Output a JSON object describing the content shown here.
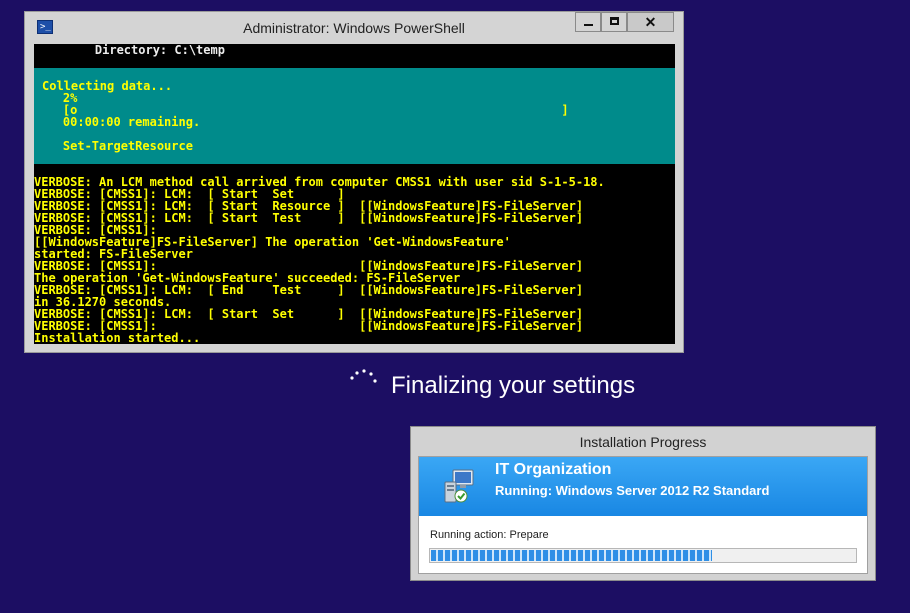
{
  "powershell": {
    "title": "Administrator: Windows PowerShell",
    "close_label": "✕",
    "directory_line": "    Directory: C:\\temp",
    "progress": {
      "activity": "Collecting data...",
      "percent_text": "    2%",
      "bar_text": "    [o                                                                   ]",
      "remaining": "    00:00:00 remaining.",
      "operation": "    Set-TargetResource"
    },
    "verbose_lines": [
      "VERBOSE: An LCM method call arrived from computer CMSS1 with user sid S-1-5-18.",
      "VERBOSE: [CMSS1]: LCM:  [ Start  Set      ]",
      "VERBOSE: [CMSS1]: LCM:  [ Start  Resource ]  [[WindowsFeature]FS-FileServer]",
      "VERBOSE: [CMSS1]: LCM:  [ Start  Test     ]  [[WindowsFeature]FS-FileServer]",
      "VERBOSE: [CMSS1]:",
      "[[WindowsFeature]FS-FileServer] The operation 'Get-WindowsFeature'",
      "started: FS-FileServer",
      "VERBOSE: [CMSS1]:                            [[WindowsFeature]FS-FileServer]",
      "The operation 'Get-WindowsFeature' succeeded: FS-FileServer",
      "VERBOSE: [CMSS1]: LCM:  [ End    Test     ]  [[WindowsFeature]FS-FileServer]",
      "in 36.1270 seconds.",
      "VERBOSE: [CMSS1]: LCM:  [ Start  Set      ]  [[WindowsFeature]FS-FileServer]",
      "VERBOSE: [CMSS1]:                            [[WindowsFeature]FS-FileServer]",
      "Installation started..."
    ]
  },
  "finalizing_text": "Finalizing your settings",
  "installation_progress": {
    "title": "Installation Progress",
    "organization": "IT Organization",
    "running": "Running: Windows Server 2012 R2 Standard",
    "action": "Running action: Prepare",
    "progress_fraction": 0.66
  },
  "colors": {
    "desktop": "#1c0e63",
    "console_text": "#ffff00",
    "console_progress_bg": "#008b8b",
    "accent_blue": "#1987e3"
  },
  "icons": [
    "powershell-icon",
    "minimize-icon",
    "maximize-icon",
    "close-icon",
    "spinner-icon",
    "installer-computer-icon"
  ]
}
